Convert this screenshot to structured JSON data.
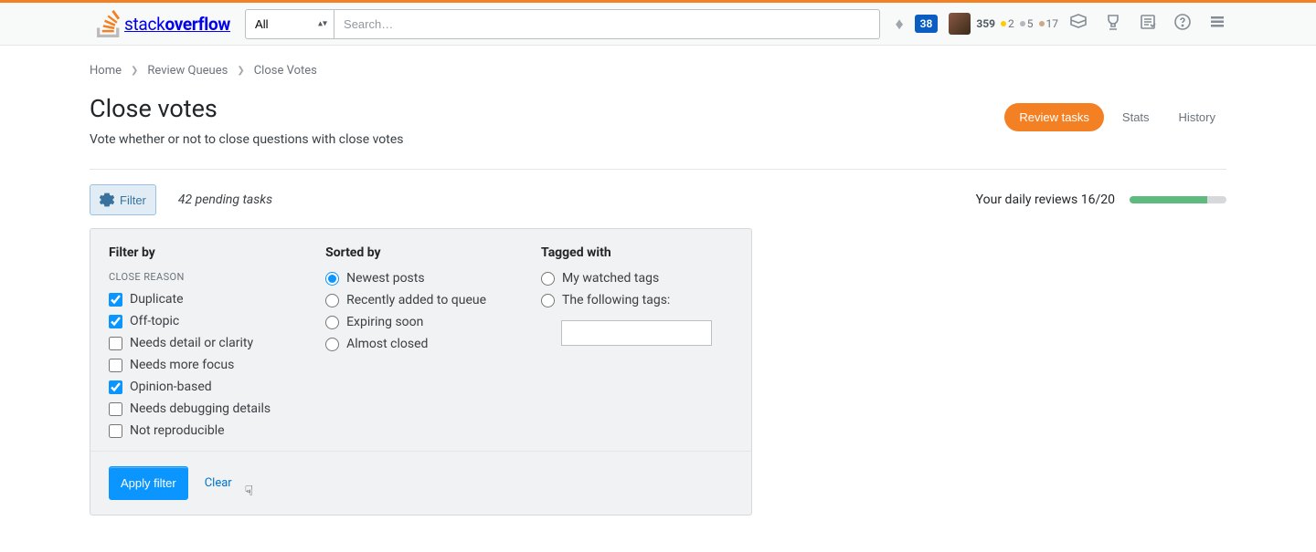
{
  "topbar": {
    "logo_stack": "stack",
    "logo_overflow": "overflow",
    "scope_selected": "All",
    "search_placeholder": "Search…",
    "inbox_count": "38",
    "user": {
      "rep": "359",
      "gold": "2",
      "silver": "5",
      "bronze": "17"
    }
  },
  "breadcrumbs": {
    "home": "Home",
    "queues": "Review Queues",
    "current": "Close Votes"
  },
  "page": {
    "title": "Close votes",
    "subtitle": "Vote whether or not to close questions with close votes"
  },
  "tabs": {
    "review": "Review tasks",
    "stats": "Stats",
    "history": "History"
  },
  "toolbar": {
    "filter_label": "Filter",
    "pending": "42 pending tasks",
    "reviews_label": "Your daily reviews 16/20"
  },
  "filter": {
    "filter_by": "Filter by",
    "close_reason": "CLOSE REASON",
    "reasons": [
      {
        "label": "Duplicate",
        "checked": true
      },
      {
        "label": "Off-topic",
        "checked": true
      },
      {
        "label": "Needs detail or clarity",
        "checked": false
      },
      {
        "label": "Needs more focus",
        "checked": false
      },
      {
        "label": "Opinion-based",
        "checked": true
      },
      {
        "label": "Needs debugging details",
        "checked": false
      },
      {
        "label": "Not reproducible",
        "checked": false
      }
    ],
    "sorted_by": "Sorted by",
    "sorts": [
      {
        "label": "Newest posts",
        "checked": true
      },
      {
        "label": "Recently added to queue",
        "checked": false
      },
      {
        "label": "Expiring soon",
        "checked": false
      },
      {
        "label": "Almost closed",
        "checked": false
      }
    ],
    "tagged_with": "Tagged with",
    "tag_opts": [
      {
        "label": "My watched tags",
        "checked": false
      },
      {
        "label": "The following tags:",
        "checked": false
      }
    ],
    "apply": "Apply filter",
    "clear": "Clear"
  }
}
